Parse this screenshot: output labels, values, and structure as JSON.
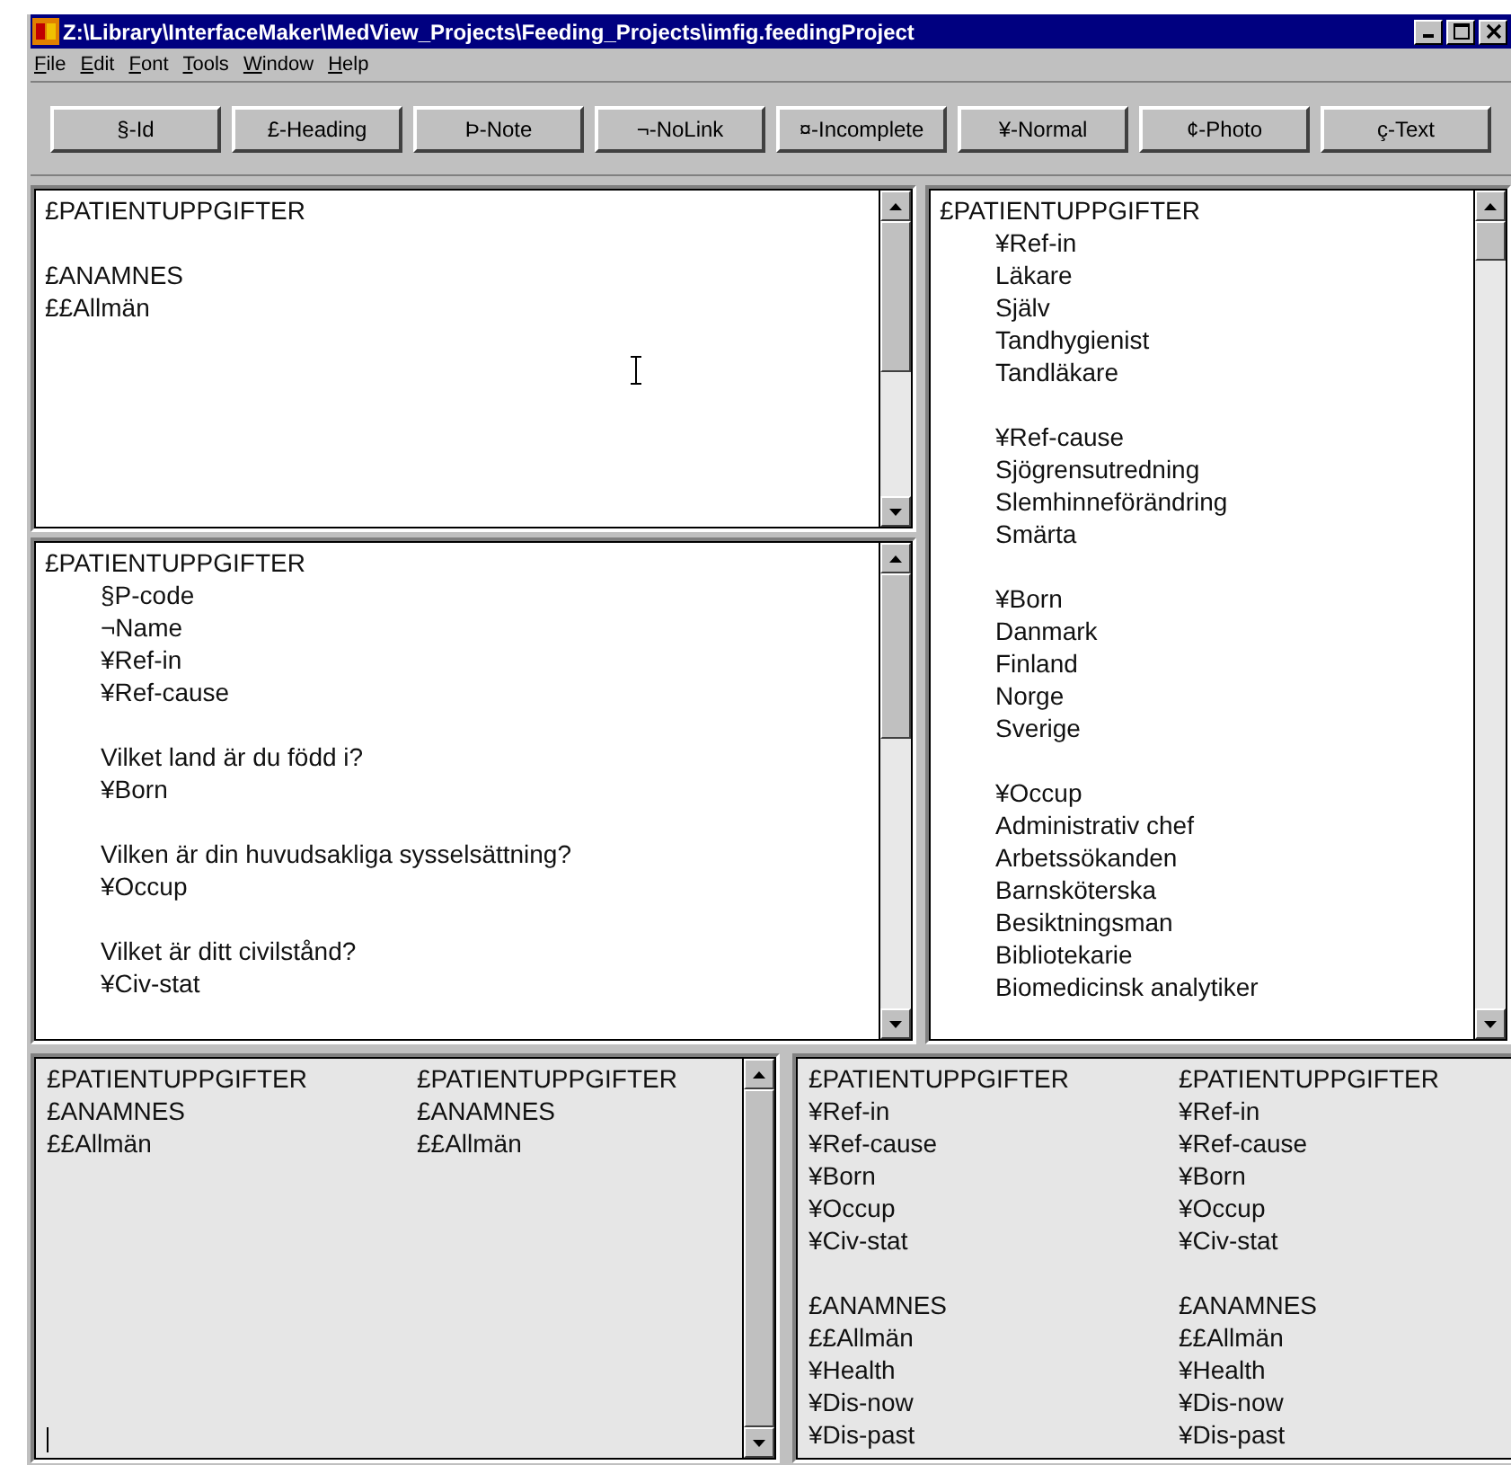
{
  "window": {
    "title": "Z:\\Library\\InterfaceMaker\\MedView_Projects\\Feeding_Projects\\imfig.feedingProject"
  },
  "menu": [
    "File",
    "Edit",
    "Font",
    "Tools",
    "Window",
    "Help"
  ],
  "toolbar": [
    "§-Id",
    "£-Heading",
    "Þ-Note",
    "¬-NoLink",
    "¤-Incomplete",
    "¥-Normal",
    "¢-Photo",
    "ç-Text"
  ],
  "template_editor": {
    "blocks": [
      [
        "£PATIENTUPPGIFTER"
      ],
      [
        "£ANAMNES",
        "££Allmän"
      ]
    ]
  },
  "form_outline": {
    "heading": "£PATIENTUPPGIFTER",
    "blocks": [
      [
        "§P-code",
        "¬Name",
        "¥Ref-in",
        "¥Ref-cause"
      ],
      [
        "Vilket land är du född i?",
        "¥Born"
      ],
      [
        "Vilken är din huvudsakliga sysselsättning?",
        "¥Occup"
      ],
      [
        "Vilket är ditt civilstånd?",
        "¥Civ-stat"
      ]
    ]
  },
  "value_list": {
    "heading": "£PATIENTUPPGIFTER",
    "blocks": [
      [
        "¥Ref-in",
        "Läkare",
        "Själv",
        "Tandhygienist",
        "Tandläkare"
      ],
      [
        "¥Ref-cause",
        "Sjögrensutredning",
        "Slemhinneförändring",
        "Smärta"
      ],
      [
        "¥Born",
        "Danmark",
        "Finland",
        "Norge",
        "Sverige"
      ],
      [
        "¥Occup",
        "Administrativ chef",
        "Arbetssökanden",
        "Barnsköterska",
        "Besiktningsman",
        "Bibliotekarie",
        "Biomedicinsk analytiker"
      ]
    ]
  },
  "compare_left": {
    "columns": [
      [
        [
          "£PATIENTUPPGIFTER",
          "£ANAMNES",
          "££Allmän"
        ]
      ],
      [
        [
          "£PATIENTUPPGIFTER",
          "£ANAMNES",
          "££Allmän"
        ]
      ]
    ]
  },
  "compare_right": {
    "columns": [
      [
        [
          "£PATIENTUPPGIFTER",
          "¥Ref-in",
          "¥Ref-cause",
          "¥Born",
          "¥Occup",
          "¥Civ-stat"
        ],
        [
          "£ANAMNES",
          "££Allmän",
          "¥Health",
          "¥Dis-now",
          "¥Dis-past"
        ]
      ],
      [
        [
          "£PATIENTUPPGIFTER",
          "¥Ref-in",
          "¥Ref-cause",
          "¥Born",
          "¥Occup",
          "¥Civ-stat"
        ],
        [
          "£ANAMNES",
          "££Allmän",
          "¥Health",
          "¥Dis-now",
          "¥Dis-past"
        ]
      ]
    ]
  }
}
